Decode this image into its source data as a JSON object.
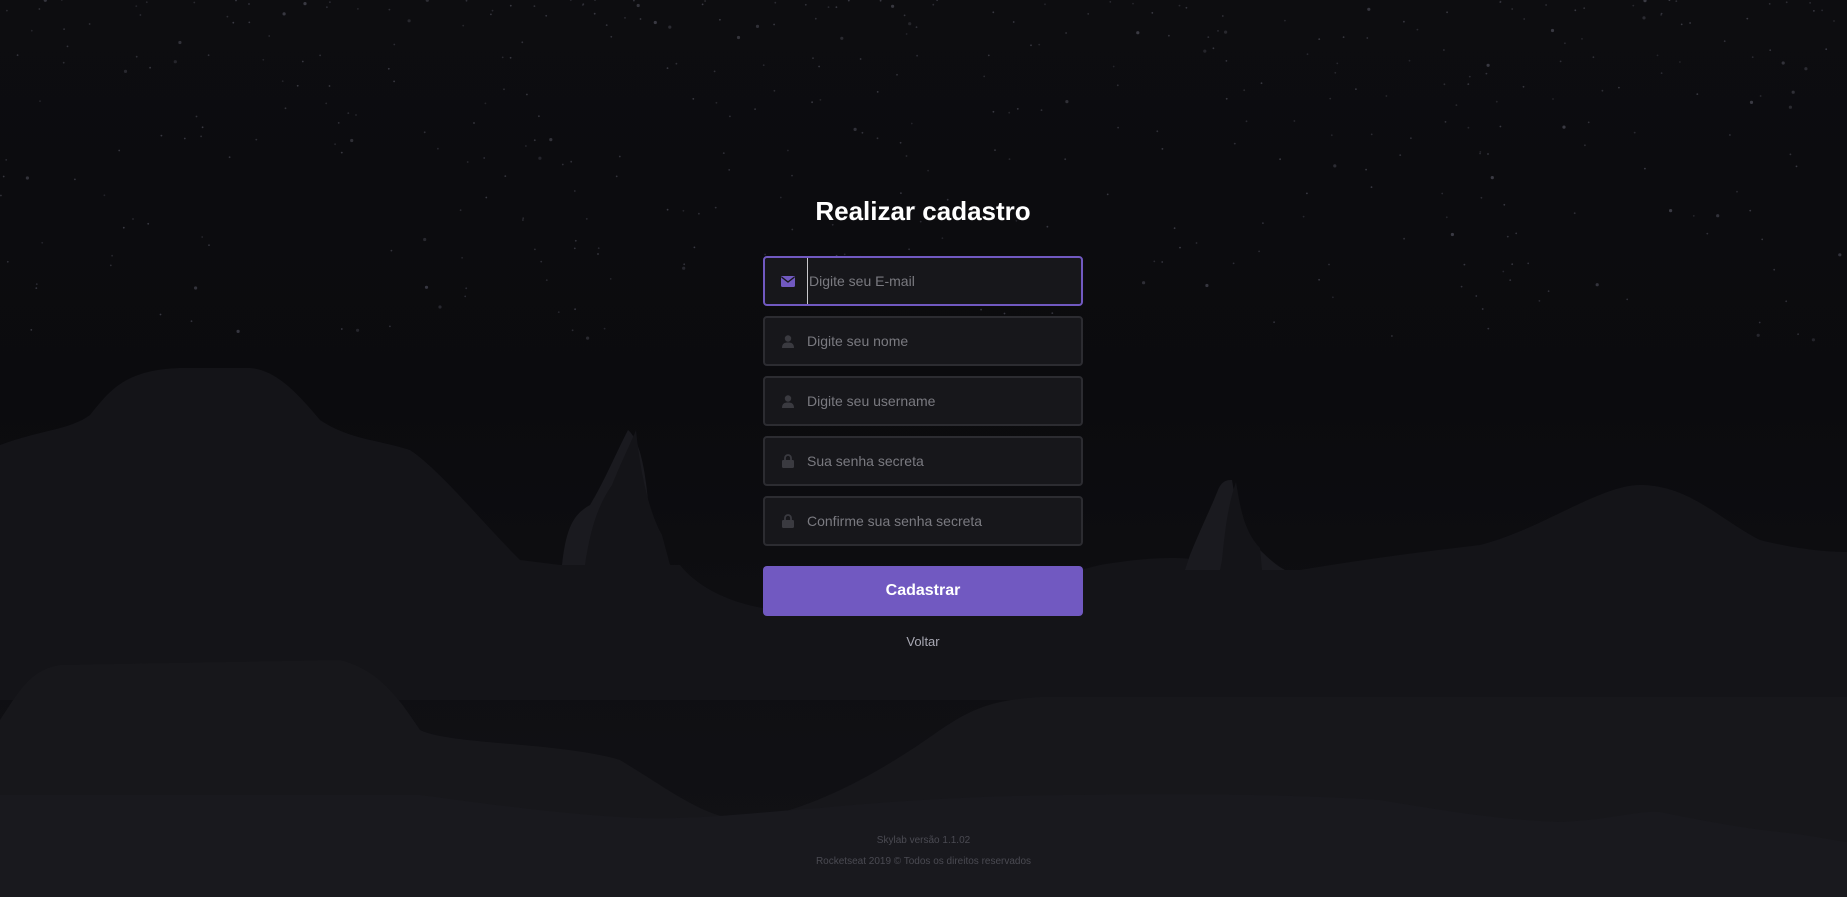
{
  "page": {
    "title": "Realizar cadastro"
  },
  "form": {
    "fields": [
      {
        "icon": "envelope-icon",
        "placeholder": "Digite seu E-mail",
        "value": ""
      },
      {
        "icon": "user-icon",
        "placeholder": "Digite seu nome",
        "value": ""
      },
      {
        "icon": "user-icon",
        "placeholder": "Digite seu username",
        "value": ""
      },
      {
        "icon": "lock-icon",
        "placeholder": "Sua senha secreta",
        "value": ""
      },
      {
        "icon": "lock-icon",
        "placeholder": "Confirme sua senha secreta",
        "value": ""
      }
    ],
    "submit_label": "Cadastrar",
    "back_label": "Voltar"
  },
  "footer": {
    "version": "Skylab versão 1.1.02",
    "copyright": "Rocketseat 2019 © Todos os direitos reservados"
  },
  "colors": {
    "accent": "#7159c1",
    "background": "#0c0c0f",
    "field_bg": "#17171b",
    "field_border": "#2c2c31",
    "icon_inactive": "#3a3a40"
  }
}
